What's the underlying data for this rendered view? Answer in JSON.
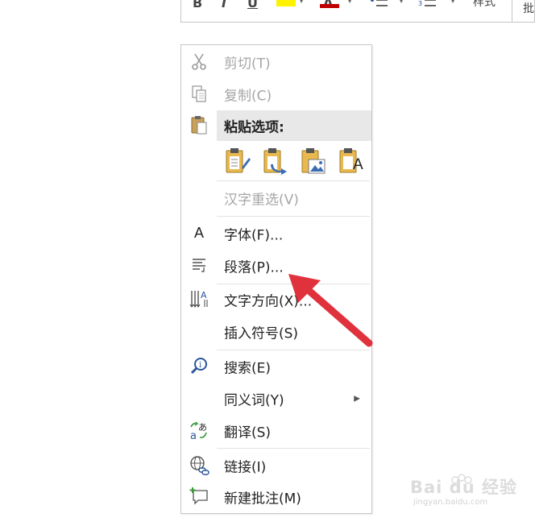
{
  "ribbon": {
    "bold_glyph": "B",
    "italic_glyph": "I",
    "underline_glyph": "U",
    "font_color_glyph": "A",
    "style_label": "样式",
    "style_label_2": "批"
  },
  "menu": {
    "items": [
      {
        "label": "剪切(T)",
        "icon": "scissors-icon",
        "enabled": false
      },
      {
        "label": "复制(C)",
        "icon": "copy-icon",
        "enabled": false
      },
      {
        "label": "粘贴选项:",
        "icon": "paste-icon",
        "enabled": true
      },
      {
        "label": "汉字重选(V)",
        "icon": "",
        "enabled": false
      },
      {
        "label": "字体(F)...",
        "icon": "font-icon",
        "enabled": true
      },
      {
        "label": "段落(P)...",
        "icon": "paragraph-icon",
        "enabled": true
      },
      {
        "label": "文字方向(X)...",
        "icon": "text-direction-icon",
        "enabled": true
      },
      {
        "label": "插入符号(S)",
        "icon": "",
        "enabled": true
      },
      {
        "label": "搜索(E)",
        "icon": "search-icon",
        "enabled": true
      },
      {
        "label": "同义词(Y)",
        "icon": "",
        "enabled": true,
        "submenu": true
      },
      {
        "label": "翻译(S)",
        "icon": "translate-icon",
        "enabled": true
      },
      {
        "label": "链接(I)",
        "icon": "link-icon",
        "enabled": true
      },
      {
        "label": "新建批注(M)",
        "icon": "new-comment-icon",
        "enabled": true
      }
    ],
    "font_icon_glyph": "A",
    "paste_options": [
      {
        "name": "keep-source-formatting-icon"
      },
      {
        "name": "merge-formatting-icon"
      },
      {
        "name": "picture-icon"
      },
      {
        "name": "keep-text-only-icon",
        "glyph": "A"
      }
    ],
    "submenu_arrow": "▶"
  },
  "annotation": {
    "arrow_color": "#e0323c"
  },
  "watermark": {
    "text": "Bai du 经验",
    "sub": "jingyan.baidu.com"
  }
}
